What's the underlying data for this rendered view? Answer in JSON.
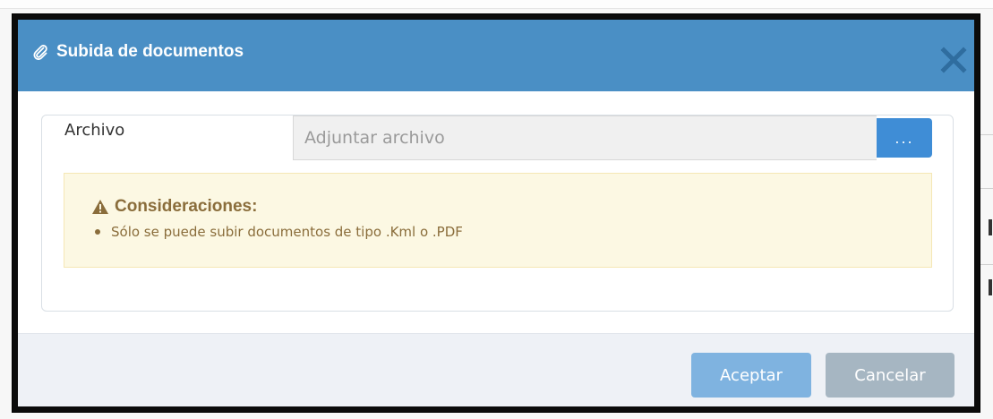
{
  "dialog": {
    "title": "Subida de documentos",
    "title_icon": "paperclip-icon",
    "close_icon": "close-icon",
    "header_color": "#4a8fc5"
  },
  "upload": {
    "label": "Archivo",
    "input_placeholder": "Adjuntar archivo",
    "input_value": "",
    "browse_label": "...",
    "browse_color": "#3f8dd6"
  },
  "alert": {
    "icon": "warning-icon",
    "title": "Consideraciones:",
    "items": [
      "Sólo se puede subir documentos de tipo .Kml o .PDF"
    ],
    "background": "#fcf8e3",
    "text_color": "#8a6d3b"
  },
  "footer": {
    "accept_label": "Aceptar",
    "cancel_label": "Cancelar",
    "accept_color": "#7fb3e0",
    "cancel_color": "#a6b6c2"
  }
}
